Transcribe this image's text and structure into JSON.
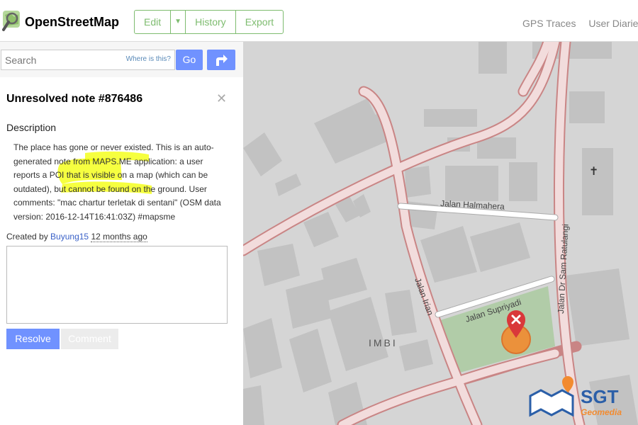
{
  "header": {
    "brand": "OpenStreetMap",
    "edit": "Edit",
    "history": "History",
    "export": "Export",
    "nav": [
      "GPS Traces",
      "User Diaries"
    ]
  },
  "search": {
    "placeholder": "Search",
    "where_is_this": "Where is this?",
    "go": "Go"
  },
  "note": {
    "title": "Unresolved note #876486",
    "description_heading": "Description",
    "description": "The place has gone or never existed. This is an auto-generated note from MAPS.ME application: a user reports a POI that is visible on a map (which can be outdated), but cannot be found on the ground. User comments: \"mac chartur terletak di sentani\" (OSM data version: 2016-12-14T16:41:03Z) #mapsme",
    "created_prefix": "Created by ",
    "created_user": "Buyung15",
    "created_when": "12 months ago",
    "resolve": "Resolve",
    "comment": "Comment"
  },
  "map": {
    "streets": [
      "Jalan Halmahera",
      "Jalan Dr Sam Ratulangi",
      "Jalan Irian",
      "Jalan Supriyadi"
    ],
    "area_label": "IMBI",
    "watermark_title": "SGT",
    "watermark_subtitle": "Geomedia"
  },
  "colors": {
    "accent": "#7ebc6f",
    "button_blue": "#7092ff",
    "road_fill": "#f2dcdc",
    "road_casing": "#c98585",
    "building": "#c2c2c2",
    "park": "#a7c99c",
    "highlight": "#f3ff00",
    "marker": "#d9383a"
  }
}
